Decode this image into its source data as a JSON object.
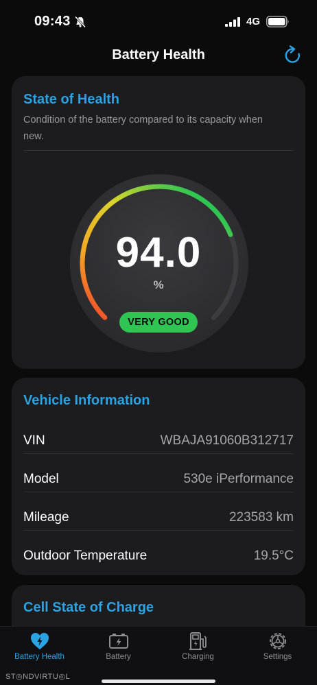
{
  "status_bar": {
    "time": "09:43",
    "network": "4G",
    "icons": [
      "bell-slash-icon",
      "signal-icon",
      "battery-icon"
    ]
  },
  "nav": {
    "title": "Battery Health",
    "refresh_icon": "refresh-icon"
  },
  "state_of_health": {
    "title": "State of Health",
    "description": "Condition of the battery compared to its capacity when new.",
    "value": "94.0",
    "unit": "%",
    "status": "VERY GOOD",
    "percent": 94.0,
    "colors": {
      "accent": "#2aa3e4",
      "good": "#2fc552",
      "gradient": [
        "#f0382d",
        "#f5a623",
        "#d8d52b",
        "#2fc552"
      ]
    }
  },
  "vehicle_info": {
    "title": "Vehicle Information",
    "rows": [
      {
        "label": "VIN",
        "value": "WBAJA91060B312717"
      },
      {
        "label": "Model",
        "value": "530e iPerformance"
      },
      {
        "label": "Mileage",
        "value": "223583 km"
      },
      {
        "label": "Outdoor Temperature",
        "value": "19.5°C"
      }
    ]
  },
  "cell_soc": {
    "title": "Cell State of Charge"
  },
  "tab_bar": {
    "tabs": [
      {
        "label": "Battery Health",
        "icon": "heart-bolt-icon",
        "active": true
      },
      {
        "label": "Battery",
        "icon": "battery-bolt-icon",
        "active": false
      },
      {
        "label": "Charging",
        "icon": "charging-station-icon",
        "active": false
      },
      {
        "label": "Settings",
        "icon": "gear-icon",
        "active": false
      }
    ]
  },
  "watermark": "ST◎NDVIRTU◎L"
}
